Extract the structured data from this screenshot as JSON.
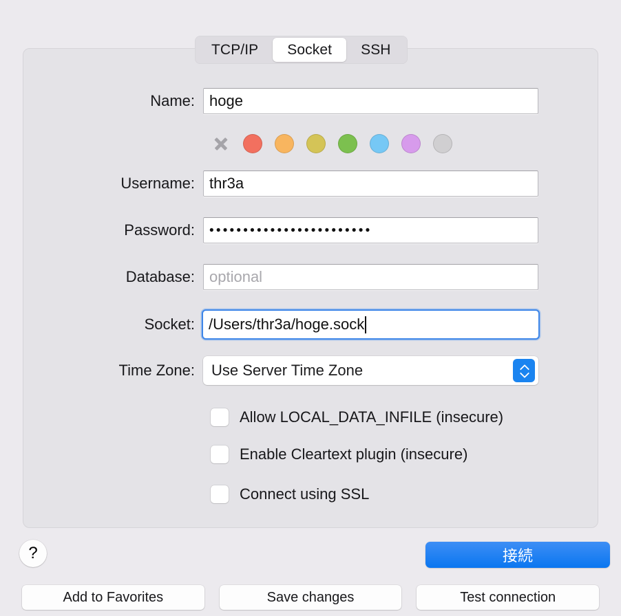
{
  "tabs": [
    {
      "label": "TCP/IP",
      "selected": false
    },
    {
      "label": "Socket",
      "selected": true
    },
    {
      "label": "SSH",
      "selected": false
    }
  ],
  "form": {
    "name": {
      "label": "Name:",
      "value": "hoge"
    },
    "username": {
      "label": "Username:",
      "value": "thr3a"
    },
    "password": {
      "label": "Password:",
      "value": "••••••••••••••••••••••••",
      "char_count": 24
    },
    "database": {
      "label": "Database:",
      "value": "",
      "placeholder": "optional"
    },
    "socket": {
      "label": "Socket:",
      "value": "/Users/thr3a/hoge.sock",
      "focused": true
    },
    "timezone": {
      "label": "Time Zone:",
      "value": "Use Server Time Zone"
    }
  },
  "color_swatches": [
    {
      "name": "no-color",
      "icon": "x-icon",
      "color": "#a5a4a9"
    },
    {
      "name": "red",
      "color": "#f2705f"
    },
    {
      "name": "orange",
      "color": "#f8b55f"
    },
    {
      "name": "yellow",
      "color": "#d4c457"
    },
    {
      "name": "green",
      "color": "#7cc04f"
    },
    {
      "name": "blue",
      "color": "#76c8f5"
    },
    {
      "name": "purple",
      "color": "#d79bec"
    },
    {
      "name": "gray",
      "color": "#d0cfd1"
    }
  ],
  "checkboxes": [
    {
      "label": "Allow LOCAL_DATA_INFILE (insecure)",
      "checked": false
    },
    {
      "label": "Enable Cleartext plugin (insecure)",
      "checked": false
    },
    {
      "label": "Connect using SSL",
      "checked": false
    }
  ],
  "buttons": {
    "help": "?",
    "connect": "接続",
    "add_to_favorites": "Add to Favorites",
    "save_changes": "Save changes",
    "test_connection": "Test connection"
  },
  "theme": {
    "window_bg": "#eceaee",
    "panel_bg": "#e4e3e7",
    "accent": "#0a76f0",
    "focus_ring": "#3e86e8",
    "text": "#17171a",
    "placeholder": "#a9a8ad"
  }
}
